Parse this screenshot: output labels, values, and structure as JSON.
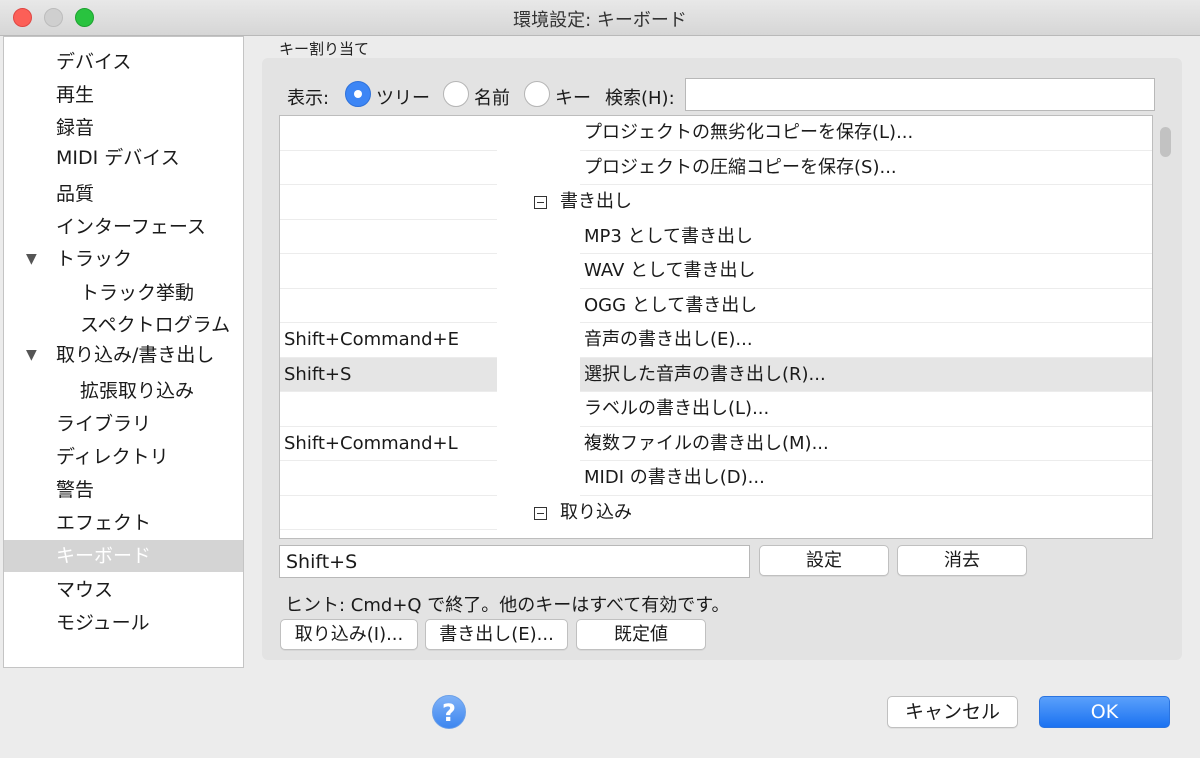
{
  "window": {
    "title": "環境設定: キーボード"
  },
  "sidebar": {
    "items": [
      {
        "label": "デバイス"
      },
      {
        "label": "再生"
      },
      {
        "label": "録音"
      },
      {
        "label": "MIDI デバイス"
      },
      {
        "label": "品質"
      },
      {
        "label": "インターフェース"
      },
      {
        "label": "トラック",
        "expanded": true
      },
      {
        "label": "トラック挙動"
      },
      {
        "label": "スペクトログラム"
      },
      {
        "label": "取り込み/書き出し",
        "expanded": true
      },
      {
        "label": "拡張取り込み"
      },
      {
        "label": "ライブラリ"
      },
      {
        "label": "ディレクトリ"
      },
      {
        "label": "警告"
      },
      {
        "label": "エフェクト"
      },
      {
        "label": "キーボード",
        "selected": true
      },
      {
        "label": "マウス"
      },
      {
        "label": "モジュール"
      }
    ],
    "triangle_glyph": "▼"
  },
  "key_assign": {
    "group_label": "キー割り当て",
    "view_label": "表示:",
    "view_options": [
      {
        "label": "ツリー",
        "selected": true
      },
      {
        "label": "名前",
        "selected": false
      },
      {
        "label": "キー",
        "selected": false
      }
    ],
    "search_label": "検索(H):",
    "search_value": ""
  },
  "tree": {
    "rows": [
      {
        "key": "",
        "command": "プロジェクトの無劣化コピーを保存(L)..."
      },
      {
        "key": "",
        "command": "プロジェクトの圧縮コピーを保存(S)..."
      },
      {
        "key": "",
        "command": "書き出し",
        "group": true
      },
      {
        "key": "",
        "command": "MP3 として書き出し"
      },
      {
        "key": "",
        "command": "WAV として書き出し"
      },
      {
        "key": "",
        "command": "OGG として書き出し"
      },
      {
        "key": "Shift+Command+E",
        "command": "音声の書き出し(E)..."
      },
      {
        "key": "Shift+S",
        "command": "選択した音声の書き出し(R)...",
        "selected": true
      },
      {
        "key": "",
        "command": "ラベルの書き出し(L)..."
      },
      {
        "key": "Shift+Command+L",
        "command": "複数ファイルの書き出し(M)..."
      },
      {
        "key": "",
        "command": "MIDI の書き出し(D)..."
      },
      {
        "key": "",
        "command": "取り込み",
        "group": true
      }
    ]
  },
  "editor": {
    "key_value": "Shift+S",
    "set_label": "設定",
    "clear_label": "消去",
    "hint": "ヒント: Cmd+Q で終了。他のキーはすべて有効です。",
    "import_label": "取り込み(I)...",
    "export_label": "書き出し(E)...",
    "defaults_label": "既定値"
  },
  "footer": {
    "help_label": "?",
    "cancel_label": "キャンセル",
    "ok_label": "OK"
  },
  "colors": {
    "accent": "#3d86f5",
    "selection": "#d4d4d4"
  }
}
